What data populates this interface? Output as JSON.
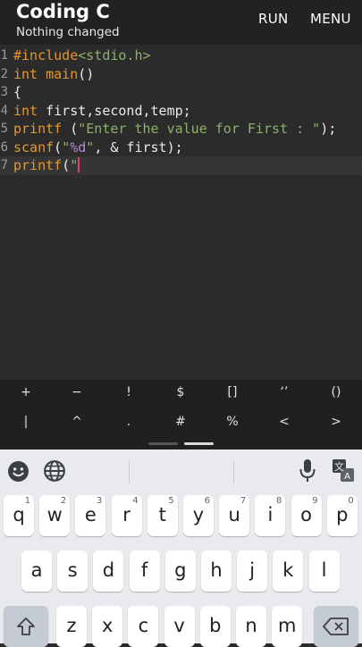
{
  "app": {
    "title": "Coding C",
    "subtitle": "Nothing changed",
    "run_label": "RUN",
    "menu_label": "MENU"
  },
  "editor": {
    "active_line": 7,
    "lines": [
      {
        "num": "1",
        "tokens": [
          {
            "t": "#include",
            "c": "kw"
          },
          {
            "t": "<stdio.h>",
            "c": "str"
          }
        ]
      },
      {
        "num": "2",
        "tokens": [
          {
            "t": "int",
            "c": "kw"
          },
          {
            "t": " "
          },
          {
            "t": "main",
            "c": "kw"
          },
          {
            "t": "()"
          }
        ]
      },
      {
        "num": "3",
        "tokens": [
          {
            "t": "{"
          }
        ]
      },
      {
        "num": "4",
        "tokens": [
          {
            "t": "int",
            "c": "kw"
          },
          {
            "t": " first,second,temp;"
          }
        ]
      },
      {
        "num": "5",
        "tokens": [
          {
            "t": "printf",
            "c": "kw"
          },
          {
            "t": " ("
          },
          {
            "t": "\"Enter the value for First : \"",
            "c": "str"
          },
          {
            "t": ");"
          }
        ]
      },
      {
        "num": "6",
        "tokens": [
          {
            "t": "scanf",
            "c": "kw"
          },
          {
            "t": "("
          },
          {
            "t": "\"",
            "c": "str"
          },
          {
            "t": "%d",
            "c": "fmt"
          },
          {
            "t": "\"",
            "c": "str"
          },
          {
            "t": ", & first);"
          }
        ]
      },
      {
        "num": "7",
        "tokens": [
          {
            "t": "printf",
            "c": "kw"
          },
          {
            "t": "("
          },
          {
            "t": "\"",
            "c": "str"
          }
        ]
      }
    ]
  },
  "symbols": {
    "row1": [
      "+",
      "−",
      "!",
      "$",
      "[]",
      "‘’",
      "()"
    ],
    "row2": [
      "|",
      "^",
      ".",
      "#",
      "%",
      "<",
      ">"
    ]
  },
  "keyboard": {
    "row1": [
      {
        "k": "q",
        "h": "1"
      },
      {
        "k": "w",
        "h": "2"
      },
      {
        "k": "e",
        "h": "3"
      },
      {
        "k": "r",
        "h": "4"
      },
      {
        "k": "t",
        "h": "5"
      },
      {
        "k": "y",
        "h": "6"
      },
      {
        "k": "u",
        "h": "7"
      },
      {
        "k": "i",
        "h": "8"
      },
      {
        "k": "o",
        "h": "9"
      },
      {
        "k": "p",
        "h": "0"
      }
    ],
    "row2": [
      "a",
      "s",
      "d",
      "f",
      "g",
      "h",
      "j",
      "k",
      "l"
    ],
    "row3": [
      "z",
      "x",
      "c",
      "v",
      "b",
      "n",
      "m"
    ],
    "toolbar_icons": [
      "emoji-icon",
      "globe-icon",
      "microphone-icon",
      "translate-icon"
    ]
  },
  "colors": {
    "accent": "#e93a66",
    "keyword": "#e6962e",
    "string": "#8fb06b",
    "format": "#b68ad3",
    "editor_bg": "#2b2b2b",
    "appbar_bg": "#222222"
  }
}
